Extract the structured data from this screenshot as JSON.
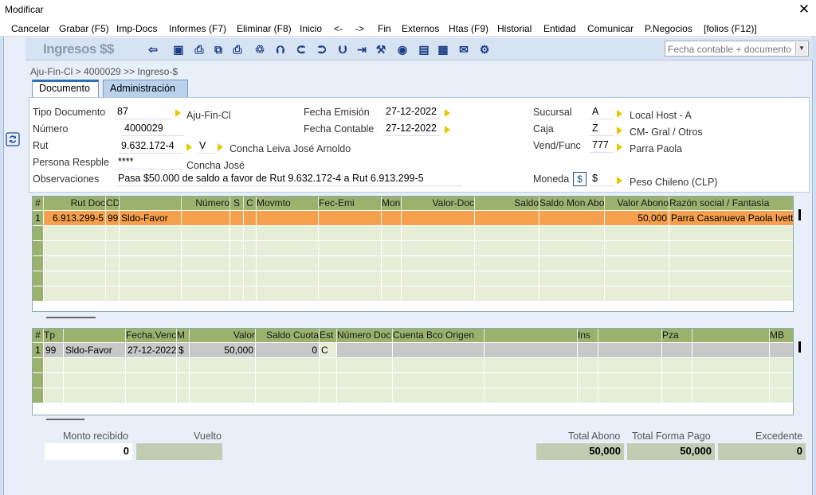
{
  "window": {
    "title": "Modificar",
    "close": "✕"
  },
  "menu": [
    "Cancelar",
    "Grabar (F5)",
    "Imp-Docs",
    "Informes (F7)",
    "Eliminar (F8)",
    "Inicio",
    "<-",
    "->",
    "Fin",
    "Externos",
    "Htas (F9)",
    "Historial",
    "Entidad",
    "Comunicar",
    "P.Negocios",
    "[folios (F12)]"
  ],
  "toolbar": {
    "logo": "Ingresos $$",
    "icons": [
      "back-icon",
      "save-icon",
      "print-preview-icon",
      "copy-icon",
      "print-icon",
      "trash-icon",
      "up-icon",
      "left-icon",
      "right-icon",
      "down-icon",
      "last-icon",
      "tools-icon",
      "view-icon",
      "id-card-icon",
      "calculator-icon",
      "chat-icon",
      "settings-icon"
    ],
    "search_combo": "Fecha contable + documento"
  },
  "breadcrumb": "Aju-Fin-Cl > 4000029 >> Ingreso-$",
  "tabs": [
    "Documento",
    "Administración"
  ],
  "form": {
    "tipo_documento_label": "Tipo Documento",
    "tipo_documento": "87",
    "tipo_documento_desc": "Aju-Fin-Cl",
    "numero_label": "Número",
    "numero": "4000029",
    "rut_label": "Rut",
    "rut": "9.632.172-4",
    "rut_tipo": "V",
    "rut_nombre": "Concha Leiva José Arnoldo",
    "persona_label": "Persona Respble",
    "persona": "****",
    "persona_nombre": "Concha José",
    "observaciones_label": "Observaciones",
    "observaciones": "Pasa $50.000 de saldo a favor de Rut 9.632.172-4 a Rut 6.913.299-5",
    "fecha_emision_label": "Fecha Emisión",
    "fecha_emision": "27-12-2022",
    "fecha_contable_label": "Fecha Contable",
    "fecha_contable": "27-12-2022",
    "sucursal_label": "Sucursal",
    "sucursal": "A",
    "sucursal_desc": "Local Host - A",
    "caja_label": "Caja",
    "caja": "Z",
    "caja_desc": "CM- Gral / Otros",
    "vend_label": "Vend/Func",
    "vend": "777",
    "vend_desc": "Parra Paola",
    "moneda_label": "Moneda",
    "moneda": "$",
    "moneda_desc": "Peso Chileno (CLP)"
  },
  "grid1": {
    "headers": [
      "#",
      "Rut Doc",
      "CD",
      "",
      "Número",
      "S",
      "C",
      "Movmto",
      "Fec-Emi",
      "Mon",
      "Valor-Doc",
      "Saldo",
      "Saldo Mon Abo",
      "Valor Abono",
      "Razón social / Fantasía"
    ],
    "row": [
      "1",
      "6.913.299-5",
      "99",
      "Sldo-Favor",
      "",
      "",
      "",
      "",
      "",
      "",
      "",
      "",
      "",
      "50,000",
      "Parra Casanueva Paola Ivette"
    ],
    "highlight_color": "#f5a04c"
  },
  "grid2": {
    "headers": [
      "#",
      "Tp",
      "",
      "Fecha.Venc",
      "M",
      "Valor",
      "Saldo Cuota",
      "Est",
      "Número Doc",
      "Cuenta Bco Origen",
      "",
      "Ins",
      "",
      "Pza",
      "",
      "MB"
    ],
    "row": [
      "1",
      "99",
      "Sldo-Favor",
      "27-12-2022",
      "$",
      "50,000",
      "0",
      "C",
      "",
      "",
      "",
      "",
      "",
      "",
      "",
      ""
    ]
  },
  "footer": {
    "monto_label": "Monto recibido",
    "monto": "0",
    "vuelto_label": "Vuelto",
    "vuelto": "",
    "total_abono_label": "Total Abono",
    "total_abono": "50,000",
    "total_forma_label": "Total Forma Pago",
    "total_forma": "50,000",
    "excedente_label": "Excedente",
    "excedente": "0"
  },
  "colors": {
    "header_green": "#9ab26e",
    "row_green": "#e6eed8",
    "highlight": "#f5a04c",
    "gray_cell": "#c8c8c8"
  }
}
